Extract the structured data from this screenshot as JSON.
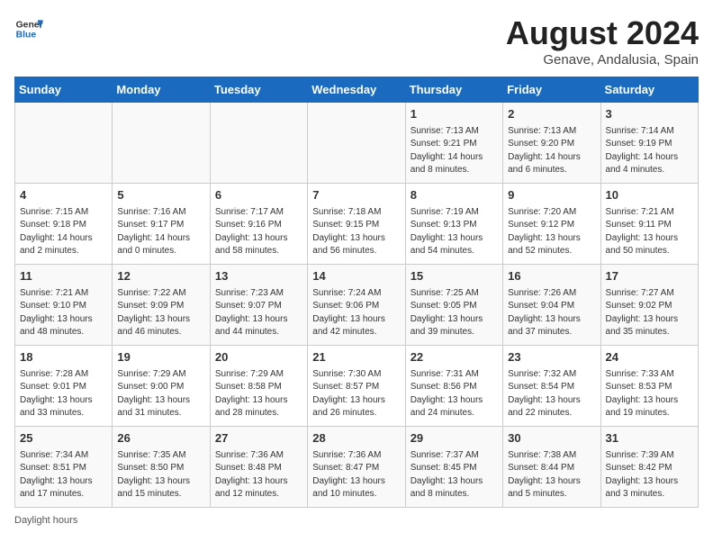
{
  "header": {
    "logo_general": "General",
    "logo_blue": "Blue",
    "month_title": "August 2024",
    "subtitle": "Genave, Andalusia, Spain"
  },
  "days_of_week": [
    "Sunday",
    "Monday",
    "Tuesday",
    "Wednesday",
    "Thursday",
    "Friday",
    "Saturday"
  ],
  "weeks": [
    [
      {
        "num": "",
        "info": ""
      },
      {
        "num": "",
        "info": ""
      },
      {
        "num": "",
        "info": ""
      },
      {
        "num": "",
        "info": ""
      },
      {
        "num": "1",
        "info": "Sunrise: 7:13 AM\nSunset: 9:21 PM\nDaylight: 14 hours and 8 minutes."
      },
      {
        "num": "2",
        "info": "Sunrise: 7:13 AM\nSunset: 9:20 PM\nDaylight: 14 hours and 6 minutes."
      },
      {
        "num": "3",
        "info": "Sunrise: 7:14 AM\nSunset: 9:19 PM\nDaylight: 14 hours and 4 minutes."
      }
    ],
    [
      {
        "num": "4",
        "info": "Sunrise: 7:15 AM\nSunset: 9:18 PM\nDaylight: 14 hours and 2 minutes."
      },
      {
        "num": "5",
        "info": "Sunrise: 7:16 AM\nSunset: 9:17 PM\nDaylight: 14 hours and 0 minutes."
      },
      {
        "num": "6",
        "info": "Sunrise: 7:17 AM\nSunset: 9:16 PM\nDaylight: 13 hours and 58 minutes."
      },
      {
        "num": "7",
        "info": "Sunrise: 7:18 AM\nSunset: 9:15 PM\nDaylight: 13 hours and 56 minutes."
      },
      {
        "num": "8",
        "info": "Sunrise: 7:19 AM\nSunset: 9:13 PM\nDaylight: 13 hours and 54 minutes."
      },
      {
        "num": "9",
        "info": "Sunrise: 7:20 AM\nSunset: 9:12 PM\nDaylight: 13 hours and 52 minutes."
      },
      {
        "num": "10",
        "info": "Sunrise: 7:21 AM\nSunset: 9:11 PM\nDaylight: 13 hours and 50 minutes."
      }
    ],
    [
      {
        "num": "11",
        "info": "Sunrise: 7:21 AM\nSunset: 9:10 PM\nDaylight: 13 hours and 48 minutes."
      },
      {
        "num": "12",
        "info": "Sunrise: 7:22 AM\nSunset: 9:09 PM\nDaylight: 13 hours and 46 minutes."
      },
      {
        "num": "13",
        "info": "Sunrise: 7:23 AM\nSunset: 9:07 PM\nDaylight: 13 hours and 44 minutes."
      },
      {
        "num": "14",
        "info": "Sunrise: 7:24 AM\nSunset: 9:06 PM\nDaylight: 13 hours and 42 minutes."
      },
      {
        "num": "15",
        "info": "Sunrise: 7:25 AM\nSunset: 9:05 PM\nDaylight: 13 hours and 39 minutes."
      },
      {
        "num": "16",
        "info": "Sunrise: 7:26 AM\nSunset: 9:04 PM\nDaylight: 13 hours and 37 minutes."
      },
      {
        "num": "17",
        "info": "Sunrise: 7:27 AM\nSunset: 9:02 PM\nDaylight: 13 hours and 35 minutes."
      }
    ],
    [
      {
        "num": "18",
        "info": "Sunrise: 7:28 AM\nSunset: 9:01 PM\nDaylight: 13 hours and 33 minutes."
      },
      {
        "num": "19",
        "info": "Sunrise: 7:29 AM\nSunset: 9:00 PM\nDaylight: 13 hours and 31 minutes."
      },
      {
        "num": "20",
        "info": "Sunrise: 7:29 AM\nSunset: 8:58 PM\nDaylight: 13 hours and 28 minutes."
      },
      {
        "num": "21",
        "info": "Sunrise: 7:30 AM\nSunset: 8:57 PM\nDaylight: 13 hours and 26 minutes."
      },
      {
        "num": "22",
        "info": "Sunrise: 7:31 AM\nSunset: 8:56 PM\nDaylight: 13 hours and 24 minutes."
      },
      {
        "num": "23",
        "info": "Sunrise: 7:32 AM\nSunset: 8:54 PM\nDaylight: 13 hours and 22 minutes."
      },
      {
        "num": "24",
        "info": "Sunrise: 7:33 AM\nSunset: 8:53 PM\nDaylight: 13 hours and 19 minutes."
      }
    ],
    [
      {
        "num": "25",
        "info": "Sunrise: 7:34 AM\nSunset: 8:51 PM\nDaylight: 13 hours and 17 minutes."
      },
      {
        "num": "26",
        "info": "Sunrise: 7:35 AM\nSunset: 8:50 PM\nDaylight: 13 hours and 15 minutes."
      },
      {
        "num": "27",
        "info": "Sunrise: 7:36 AM\nSunset: 8:48 PM\nDaylight: 13 hours and 12 minutes."
      },
      {
        "num": "28",
        "info": "Sunrise: 7:36 AM\nSunset: 8:47 PM\nDaylight: 13 hours and 10 minutes."
      },
      {
        "num": "29",
        "info": "Sunrise: 7:37 AM\nSunset: 8:45 PM\nDaylight: 13 hours and 8 minutes."
      },
      {
        "num": "30",
        "info": "Sunrise: 7:38 AM\nSunset: 8:44 PM\nDaylight: 13 hours and 5 minutes."
      },
      {
        "num": "31",
        "info": "Sunrise: 7:39 AM\nSunset: 8:42 PM\nDaylight: 13 hours and 3 minutes."
      }
    ]
  ],
  "footer": "Daylight hours"
}
